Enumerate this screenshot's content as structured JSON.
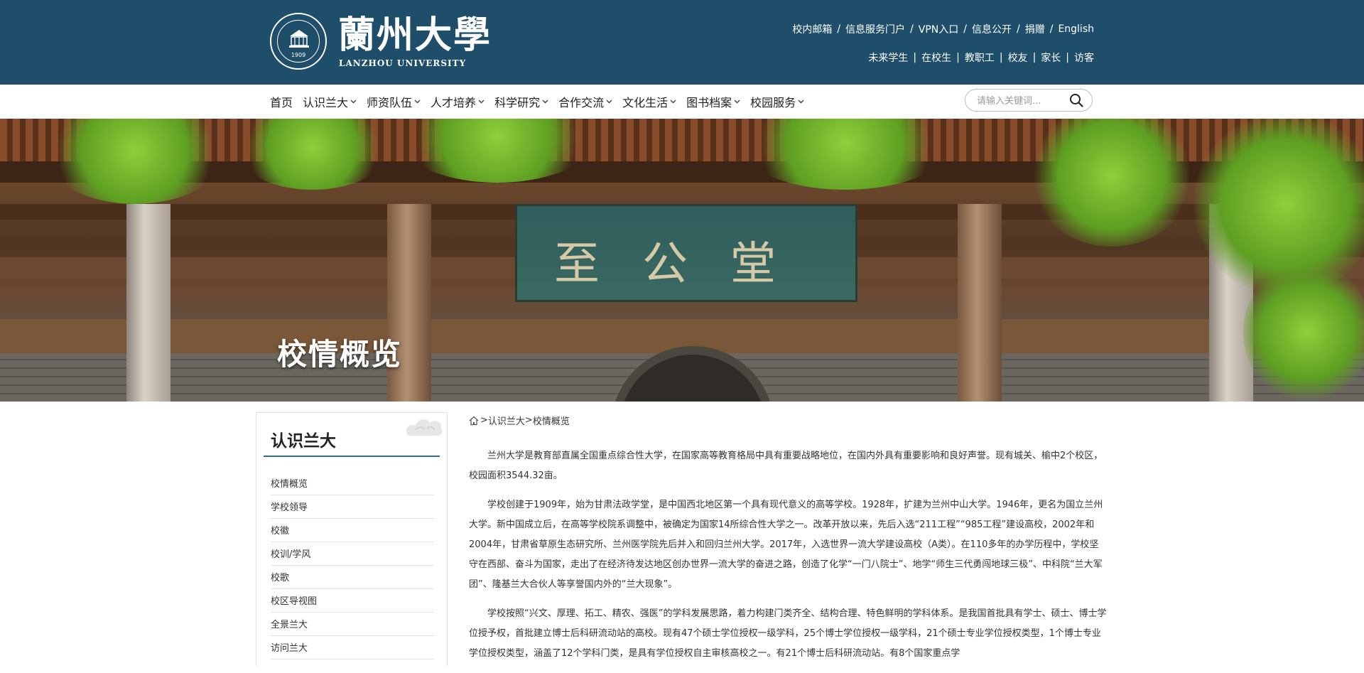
{
  "header": {
    "logo_cn": "蘭州大學",
    "logo_en": "LANZHOU UNIVERSITY",
    "seal_year": "1909",
    "links_row1": [
      "校内邮箱",
      "信息服务门户",
      "VPN入口",
      "信息公开",
      "捐赠",
      "English"
    ],
    "links_row2": [
      "未来学生",
      "在校生",
      "教职工",
      "校友",
      "家长",
      "访客"
    ],
    "bg_color": "#1f4e6a"
  },
  "nav": {
    "items": [
      {
        "label": "首页",
        "has_dropdown": false
      },
      {
        "label": "认识兰大",
        "has_dropdown": true
      },
      {
        "label": "师资队伍",
        "has_dropdown": true
      },
      {
        "label": "人才培养",
        "has_dropdown": true
      },
      {
        "label": "科学研究",
        "has_dropdown": true
      },
      {
        "label": "合作交流",
        "has_dropdown": true
      },
      {
        "label": "文化生活",
        "has_dropdown": true
      },
      {
        "label": "图书档案",
        "has_dropdown": true
      },
      {
        "label": "校园服务",
        "has_dropdown": true
      }
    ],
    "search_placeholder": "请输入关键词...",
    "search_icon": "search-icon"
  },
  "banner": {
    "title": "校情概览",
    "plaque_text": "至公堂"
  },
  "sidebar": {
    "title": "认识兰大",
    "accent_color": "#2a6da8",
    "items": [
      "校情概览",
      "学校领导",
      "校徽",
      "校训/学风",
      "校歌",
      "校区导视图",
      "全景兰大",
      "访问兰大"
    ]
  },
  "breadcrumb": {
    "home_icon": "home-icon",
    "items": [
      "认识兰大",
      "校情概览"
    ],
    "separator": ">"
  },
  "content": {
    "paragraphs": [
      "兰州大学是教育部直属全国重点综合性大学，在国家高等教育格局中具有重要战略地位，在国内外具有重要影响和良好声誉。现有城关、榆中2个校区，校园面积3544.32亩。",
      "学校创建于1909年，始为甘肃法政学堂，是中国西北地区第一个具有现代意义的高等学校。1928年，扩建为兰州中山大学。1946年，更名为国立兰州大学。新中国成立后，在高等学校院系调整中，被确定为国家14所综合性大学之一。改革开放以来，先后入选“211工程”“985工程”建设高校，2002年和2004年，甘肃省草原生态研究所、兰州医学院先后并入和回归兰州大学。2017年，入选世界一流大学建设高校（A类）。在110多年的办学历程中，学校坚守在西部、奋斗为国家，走出了在经济待发达地区创办世界一流大学的奋进之路，创造了化学“一门八院士”、地学“师生三代勇闯地球三极”、中科院“兰大军团”、隆基兰大合伙人等享誉国内外的“兰大现象”。",
      "学校按照“兴文、厚理、拓工、精农、强医”的学科发展思路，着力构建门类齐全、结构合理、特色鲜明的学科体系。是我国首批具有学士、硕士、博士学位授予权，首批建立博士后科研流动站的高校。现有47个硕士学位授权一级学科，25个博士学位授权一级学科，21个硕士专业学位授权类型，1个博士专业学位授权类型，涵盖了12个学科门类，是具有学位授权自主审核高校之一。有21个博士后科研流动站。有8个国家重点学"
    ]
  }
}
